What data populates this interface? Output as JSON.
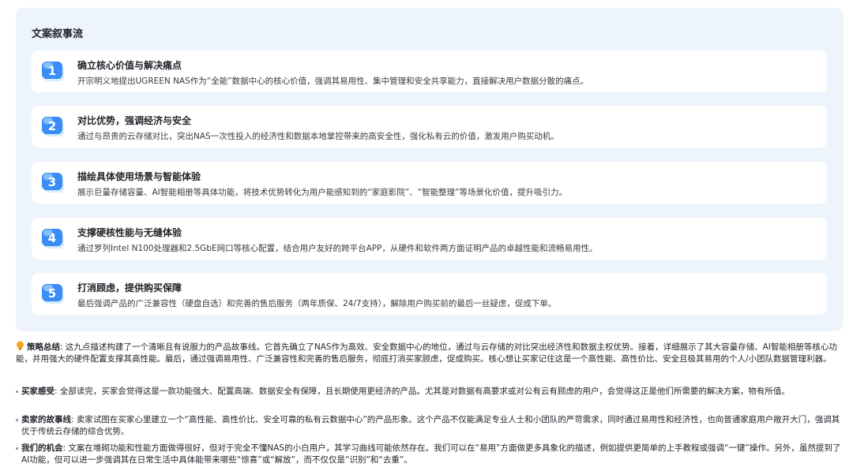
{
  "panel": {
    "title": "文案叙事流",
    "items": [
      {
        "num": "1",
        "title": "确立核心价值与解决痛点",
        "desc": "开宗明义地提出UGREEN NAS作为“全能”数据中心的核心价值，强调其易用性、集中管理和安全共享能力，直接解决用户数据分散的痛点。"
      },
      {
        "num": "2",
        "title": "对比优势，强调经济与安全",
        "desc": "通过与昂贵的云存储对比，突出NAS一次性投入的经济性和数据本地掌控带来的高安全性，强化私有云的价值，激发用户购买动机。"
      },
      {
        "num": "3",
        "title": "描绘具体使用场景与智能体验",
        "desc": "展示巨量存储容量、AI智能相册等具体功能，将技术优势转化为用户能感知到的“家庭影院”、“智能整理”等场景化价值，提升吸引力。"
      },
      {
        "num": "4",
        "title": "支撑硬核性能与无缝体验",
        "desc": "通过罗列Intel N100处理器和2.5GbE网口等核心配置，结合用户友好的跨平台APP，从硬件和软件两方面证明产品的卓越性能和流畅易用性。"
      },
      {
        "num": "5",
        "title": "打消顾虑，提供购买保障",
        "desc": "最后强调产品的广泛兼容性（硬盘自选）和完善的售后服务（两年质保、24/7支持），解除用户购买前的最后一丝疑虑，促成下单。"
      }
    ]
  },
  "summary": {
    "label": "策略总结",
    "text": ": 这九点描述构建了一个清晰且有说服力的产品故事线。它首先确立了NAS作为高效、安全数据中心的地位，通过与云存储的对比突出经济性和数据主权优势。接着，详细展示了其大容量存储、AI智能相册等核心功能，并用强大的硬件配置支撑其高性能。最后，通过强调易用性、广泛兼容性和完善的售后服务，彻底打消买家顾虑，促成购买。核心想让买家记住这是一个高性能、高性价比、安全且极其易用的个人/小团队数据管理利器。"
  },
  "bullets": [
    {
      "label": "买家感受",
      "text": ": 全部读完，买家会觉得这是一款功能强大、配置高端、数据安全有保障，且长期使用更经济的产品。尤其是对数据有高要求或对公有云有顾虑的用户，会觉得这正是他们所需要的解决方案，物有所值。"
    },
    {
      "label": "卖家的故事线",
      "text": ": 卖家试图在买家心里建立一个“高性能、高性价比、安全可靠的私有云数据中心”的产品形象。这个产品不仅能满足专业人士和小团队的严苛需求，同时通过易用性和经济性，也向普通家庭用户敞开大门，强调其优于传统云存储的综合优势。"
    },
    {
      "label": "我们的机会",
      "text": ": 文案在堆砌功能和性能方面做得很好，但对于完全不懂NAS的小白用户，其学习曲线可能依然存在。我们可以在“易用”方面做更多具象化的描述，例如提供更简单的上手教程或强调“一键”操作。另外，虽然提到了AI功能，但可以进一步强调其在日常生活中具体能带来哪些“惊喜”或“解放”，而不仅仅是“识别”和“去重”。"
    }
  ],
  "colors": {
    "panel_bg": "#eef4fc",
    "icon_blue": "#2f7cf6",
    "icon_light": "#9fd0ff",
    "bulb": "#f5a524"
  }
}
